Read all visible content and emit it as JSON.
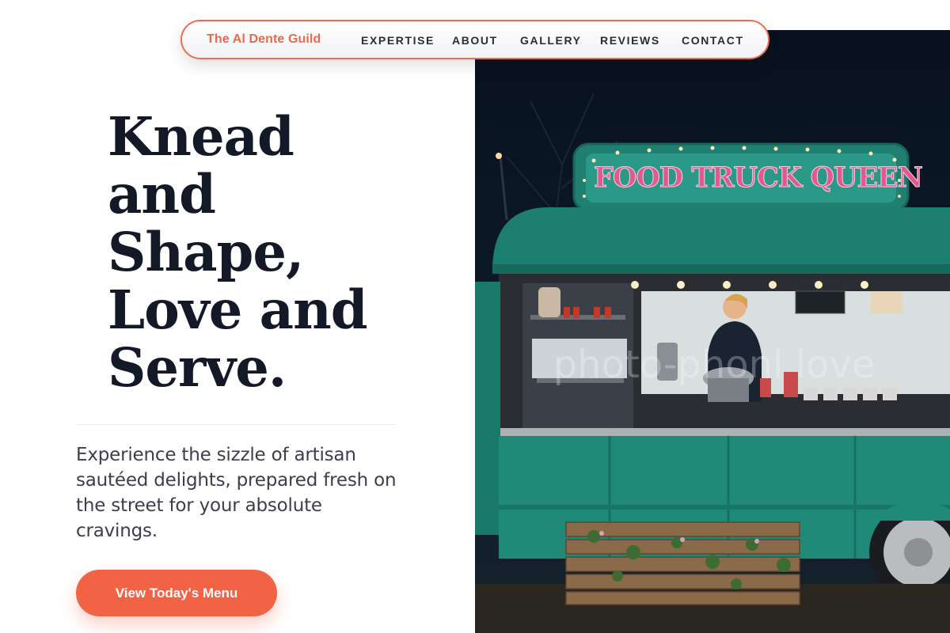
{
  "nav": {
    "brand": "The Al Dente Guild",
    "links": [
      "EXPERTISE",
      "ABOUT",
      "GALLERY",
      "REVIEWS",
      "CONTACT"
    ]
  },
  "hero": {
    "headline_lines": [
      "Knead",
      "and",
      "Shape,",
      "Love and",
      "Serve."
    ],
    "subtext": "Experience the sizzle of artisan sautéed delights, prepared fresh on the street for your absolute cravings.",
    "cta_label": "View Today's Menu"
  },
  "photo": {
    "truck_sign": "FOOD TRUCK QUEEN",
    "watermark": "photo-phonl love"
  },
  "colors": {
    "accent": "#f26244",
    "brand": "#e86a4e",
    "headline": "#131927",
    "truck_teal": "#1f8a78"
  }
}
